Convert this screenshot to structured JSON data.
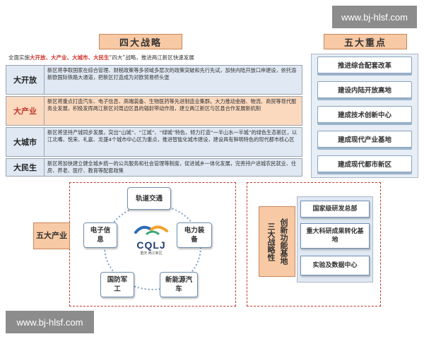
{
  "watermark_top": "www.bj-hlsf.com",
  "watermark_bottom": "www.bj-hlsf.com",
  "four_strategies": {
    "title": "四大战略",
    "subtitle_prefix": "全面实施",
    "subtitle_highlight": "大开放、大产业、大城市、大民生",
    "subtitle_suffix": "“四大”战略，推进两江新区快速发展",
    "rows": [
      {
        "label": "大开放",
        "text": "新区将争取国家在综合管理、财税政策等多领域多层次的政策突破和先行先试，加快内陆开放口岸建设，依托渝新欧国际铁路大通道，把新区打造成为对欧贸易桥头堡"
      },
      {
        "label": "大产业",
        "text": "新区将重点打造汽车、电子信息、高端装备、生物医药等先进制造业集群。大力推动金融、物流、商贸等现代服务业发展，积极发挥两江新区对周边区县的辐射带动作用，建立两江新区与区县合作发展新机制"
      },
      {
        "label": "大城市",
        "text": "新区将坚持产城同步发展，突出“山城”、“江城”、“绿城”特色，倾力打造“一半山水一半城”的绿色生态新区，以江北嘴、悦来、礼嘉、龙盛4个城市中心区为重点，推进智能化城市建设，建设具有鲜明特色的现代都市核心区"
      },
      {
        "label": "大民生",
        "text": "新区将加快建立健全城乡统一的公共服务和社会管理等制度，促进城乡一体化发展，完善持户进城农民就业、住房、养老、医疗、教育等配套政策"
      }
    ]
  },
  "five_priorities": {
    "title": "五大重点",
    "items": [
      "推进综合配套改革",
      "建设内陆开放高地",
      "建成技术创新中心",
      "建成现代产业基地",
      "建成现代都市新区"
    ]
  },
  "five_industries": {
    "label": "五大产业",
    "items": [
      "轨道交通",
      "电力装备",
      "新能源汽车",
      "国防军工",
      "电子信息"
    ],
    "logo_text": "CQLJ",
    "logo_subtext": "重庆·两江新区"
  },
  "three_bases": {
    "label_left": "三大战略性",
    "label_right": "创新功能基地",
    "items": [
      "国家级研发总部",
      "重大科研成果转化基地",
      "实验及数据中心"
    ]
  },
  "colors": {
    "accent_orange": "#f7c9a4",
    "row_blue": "#dfe8f3",
    "row_orange": "#fbd9bf",
    "highlight_red": "#d2342b",
    "dashed_red": "#c0392b"
  }
}
